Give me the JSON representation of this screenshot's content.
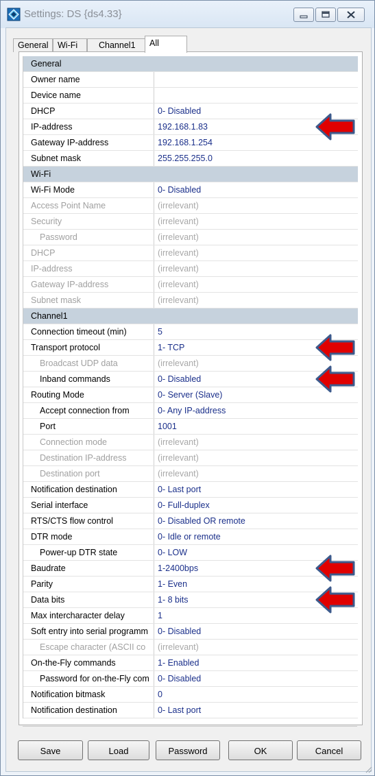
{
  "window": {
    "title": "Settings: DS {ds4.33}",
    "icons": {
      "app": "app-icon",
      "minimize": "minimize-icon",
      "maximize": "maximize-icon",
      "close": "close-icon"
    }
  },
  "tabs": [
    {
      "label": "General"
    },
    {
      "label": "Wi-Fi"
    },
    {
      "label": "Channel1"
    },
    {
      "label": "All",
      "active": true
    }
  ],
  "colors": {
    "section_header": "#c6d2dd",
    "value_text": "#1a2f8a",
    "disabled_text": "#a0a0a0",
    "annotation_arrow": "#e00000"
  },
  "rows": [
    {
      "type": "section",
      "name": "General"
    },
    {
      "name": "Owner name",
      "value": ""
    },
    {
      "name": "Device name",
      "value": ""
    },
    {
      "name": "DHCP",
      "value": "0- Disabled"
    },
    {
      "name": "IP-address",
      "value": "192.168.1.83",
      "annotated": true
    },
    {
      "name": "Gateway IP-address",
      "value": "192.168.1.254"
    },
    {
      "name": "Subnet mask",
      "value": "255.255.255.0"
    },
    {
      "type": "section",
      "name": "Wi-Fi"
    },
    {
      "name": "Wi-Fi Mode",
      "value": "0- Disabled"
    },
    {
      "name": "Access Point Name",
      "value": "(irrelevant)",
      "disabled": true
    },
    {
      "name": "Security",
      "value": "(irrelevant)",
      "disabled": true
    },
    {
      "name": "Password",
      "value": "(irrelevant)",
      "disabled": true,
      "indent": 1
    },
    {
      "name": "DHCP",
      "value": "(irrelevant)",
      "disabled": true
    },
    {
      "name": "IP-address",
      "value": "(irrelevant)",
      "disabled": true
    },
    {
      "name": "Gateway IP-address",
      "value": "(irrelevant)",
      "disabled": true
    },
    {
      "name": "Subnet mask",
      "value": "(irrelevant)",
      "disabled": true
    },
    {
      "type": "section",
      "name": "Channel1"
    },
    {
      "name": "Connection timeout (min)",
      "value": "5"
    },
    {
      "name": "Transport protocol",
      "value": "1- TCP",
      "annotated": true
    },
    {
      "name": "Broadcast UDP data",
      "value": "(irrelevant)",
      "disabled": true,
      "indent": 1
    },
    {
      "name": "Inband commands",
      "value": "0- Disabled",
      "indent": 1,
      "annotated": true
    },
    {
      "name": "Routing Mode",
      "value": "0- Server (Slave)"
    },
    {
      "name": "Accept connection from",
      "value": "0- Any IP-address",
      "indent": 1
    },
    {
      "name": "Port",
      "value": "1001",
      "indent": 1
    },
    {
      "name": "Connection mode",
      "value": "(irrelevant)",
      "disabled": true,
      "indent": 1
    },
    {
      "name": "Destination IP-address",
      "value": "(irrelevant)",
      "disabled": true,
      "indent": 1
    },
    {
      "name": "Destination port",
      "value": "(irrelevant)",
      "disabled": true,
      "indent": 1
    },
    {
      "name": "Notification destination",
      "value": "0- Last port"
    },
    {
      "name": "Serial interface",
      "value": "0- Full-duplex"
    },
    {
      "name": "RTS/CTS flow control",
      "value": "0- Disabled OR remote"
    },
    {
      "name": "DTR mode",
      "value": "0- Idle or remote"
    },
    {
      "name": "Power-up DTR state",
      "value": "0- LOW",
      "indent": 1
    },
    {
      "name": "Baudrate",
      "value": "1-2400bps",
      "annotated": true
    },
    {
      "name": "Parity",
      "value": "1- Even"
    },
    {
      "name": "Data bits",
      "value": "1- 8 bits",
      "annotated": true
    },
    {
      "name": "Max intercharacter delay",
      "value": "1"
    },
    {
      "name": "Soft entry into serial programm",
      "value": "0- Disabled"
    },
    {
      "name": "Escape character (ASCII co",
      "value": "(irrelevant)",
      "disabled": true,
      "indent": 1
    },
    {
      "name": "On-the-Fly commands",
      "value": "1- Enabled"
    },
    {
      "name": "Password for on-the-Fly com",
      "value": "0- Disabled",
      "indent": 1
    },
    {
      "name": "Notification bitmask",
      "value": "0"
    },
    {
      "name": "Notification destination",
      "value": "0- Last port"
    }
  ],
  "buttons": [
    {
      "label": "Save"
    },
    {
      "label": "Load"
    },
    {
      "label": "Password"
    },
    {
      "label": "OK"
    },
    {
      "label": "Cancel"
    }
  ]
}
